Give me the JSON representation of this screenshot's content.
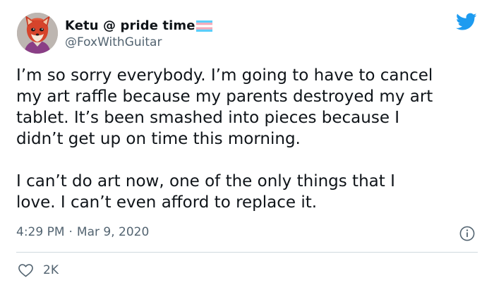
{
  "user": {
    "display_name": "Ketu @ pride time",
    "handle": "@FoxWithGuitar",
    "avatar": "fox-character-avatar",
    "name_badge": "trans-pride-flag-icon"
  },
  "tweet": {
    "paragraphs": [
      {
        "lines": [
          "I’m so sorry everybody. I’m going to have to cancel",
          "my art raffle because my parents destroyed my art",
          "tablet. It’s been smashed into pieces because I",
          "didn’t get up on time this morning."
        ]
      },
      {
        "lines": [
          "I can’t do art now, one of the only things that I",
          "love. I can’t even afford to replace it."
        ]
      }
    ]
  },
  "meta": {
    "time": "4:29 PM",
    "separator": "·",
    "date": "Mar 9, 2020"
  },
  "engagement": {
    "likes": "2K"
  },
  "icons": {
    "brand": "twitter-bird-icon",
    "info": "info-icon",
    "like": "heart-icon"
  },
  "colors": {
    "brand_blue": "#1d9bf0",
    "text_primary": "#0f1419",
    "text_secondary": "#536471",
    "divider": "#cfd9de",
    "flag_blue": "#5bcefa",
    "flag_pink": "#f5a9b8",
    "flag_white": "#ffffff"
  }
}
